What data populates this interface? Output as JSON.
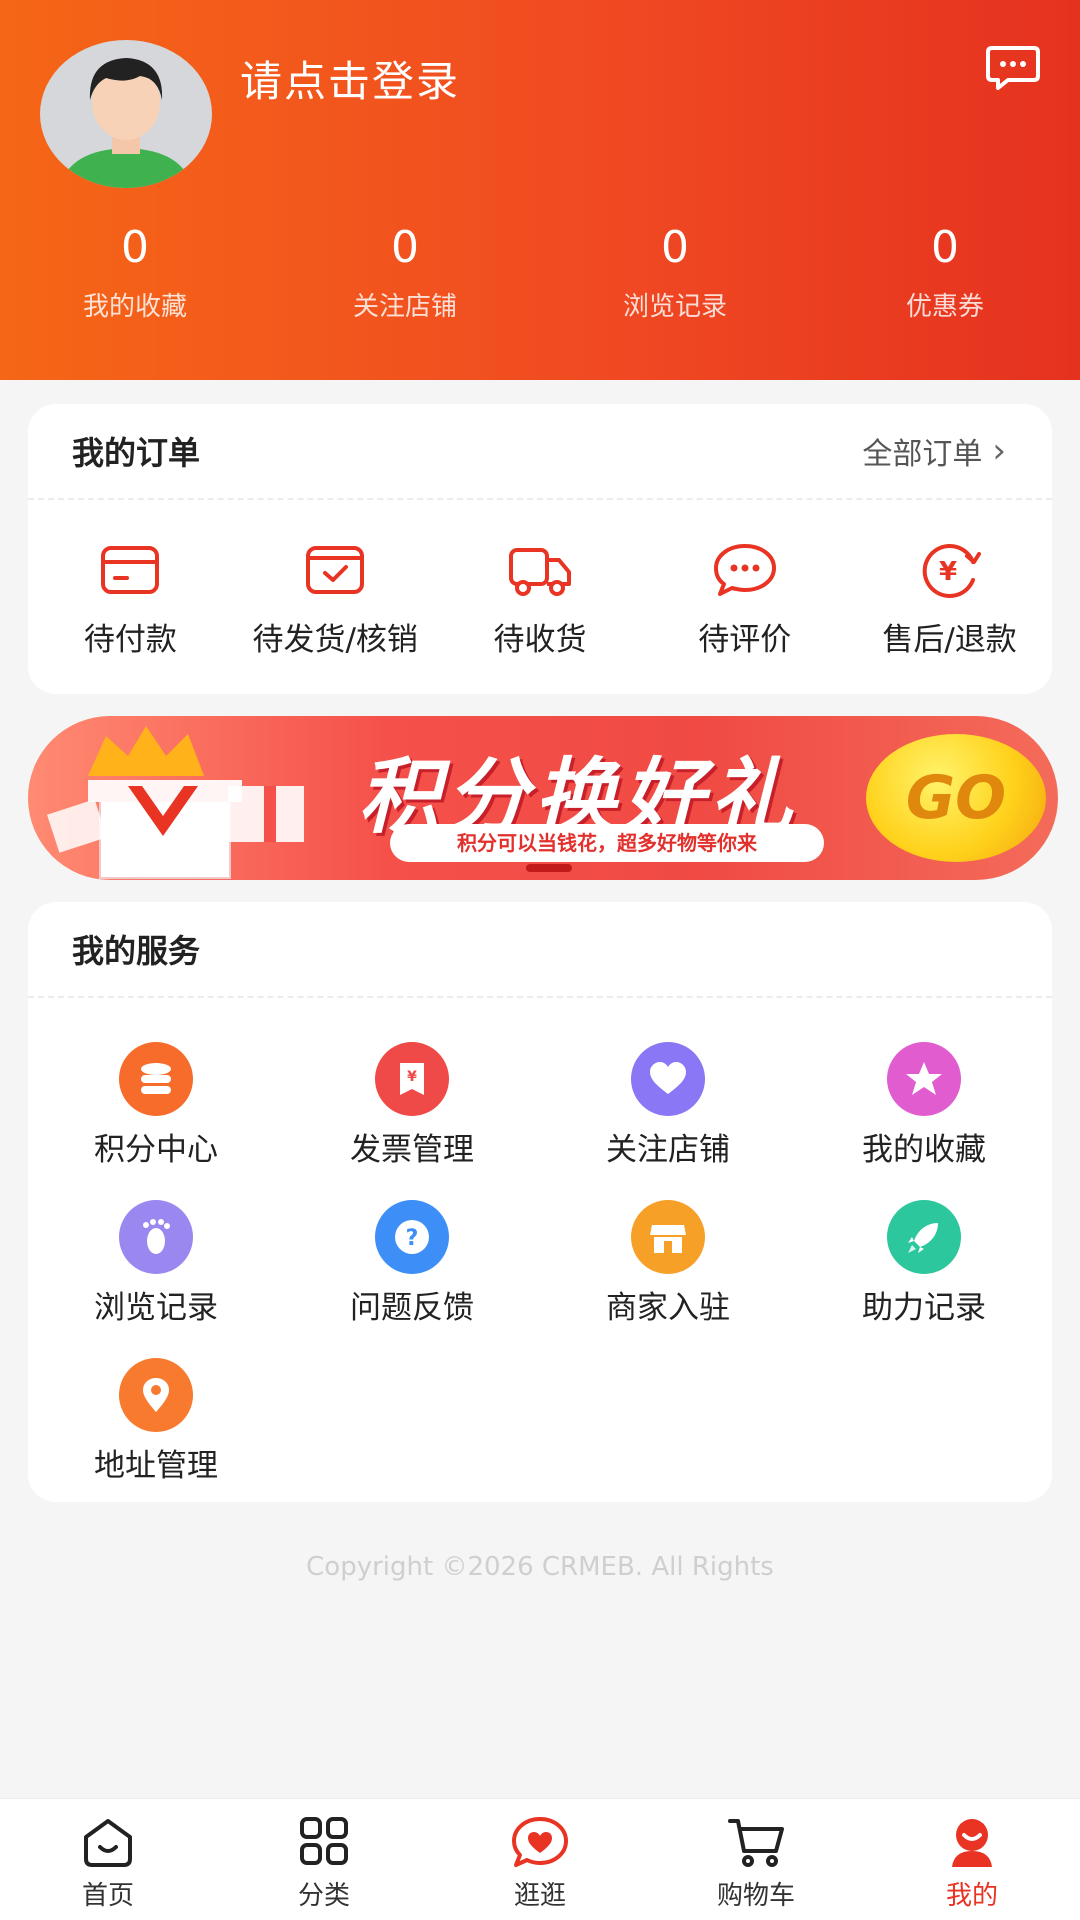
{
  "header": {
    "login_text": "请点击登录",
    "stats": [
      {
        "value": "0",
        "label": "我的收藏"
      },
      {
        "value": "0",
        "label": "关注店铺"
      },
      {
        "value": "0",
        "label": "浏览记录"
      },
      {
        "value": "0",
        "label": "优惠券"
      }
    ]
  },
  "orders": {
    "title": "我的订单",
    "all_label": "全部订单",
    "items": [
      {
        "label": "待付款",
        "icon": "wallet-icon"
      },
      {
        "label": "待发货/核销",
        "icon": "package-check-icon"
      },
      {
        "label": "待收货",
        "icon": "truck-icon"
      },
      {
        "label": "待评价",
        "icon": "comment-icon"
      },
      {
        "label": "售后/退款",
        "icon": "yen-refund-icon"
      }
    ]
  },
  "banner": {
    "title": "积分换好礼",
    "subtitle": "积分可以当钱花，超多好物等你来",
    "go": "GO"
  },
  "services": {
    "title": "我的服务",
    "items": [
      {
        "label": "积分中心",
        "icon": "coins-icon",
        "color": "#f76b2b"
      },
      {
        "label": "发票管理",
        "icon": "invoice-icon",
        "color": "#ef4a47"
      },
      {
        "label": "关注店铺",
        "icon": "heart-icon",
        "color": "#8a77f5"
      },
      {
        "label": "我的收藏",
        "icon": "star-icon",
        "color": "#e05ccf"
      },
      {
        "label": "浏览记录",
        "icon": "footprint-icon",
        "color": "#9b87f0"
      },
      {
        "label": "问题反馈",
        "icon": "question-icon",
        "color": "#3d8ef7"
      },
      {
        "label": "商家入驻",
        "icon": "store-icon",
        "color": "#f7a028"
      },
      {
        "label": "助力记录",
        "icon": "rocket-icon",
        "color": "#2dc79d"
      },
      {
        "label": "地址管理",
        "icon": "location-icon",
        "color": "#f77a2e"
      }
    ]
  },
  "copyright": "Copyright ©2026 CRMEB. All Rights",
  "tabbar": {
    "items": [
      {
        "label": "首页",
        "icon": "home-icon"
      },
      {
        "label": "分类",
        "icon": "grid-icon"
      },
      {
        "label": "逛逛",
        "icon": "heart-chat-icon"
      },
      {
        "label": "购物车",
        "icon": "cart-icon"
      },
      {
        "label": "我的",
        "icon": "profile-icon"
      }
    ],
    "active_index": 4
  },
  "colors": {
    "accent": "#e93323",
    "header_start": "#f56616",
    "header_end": "#e5321f"
  }
}
